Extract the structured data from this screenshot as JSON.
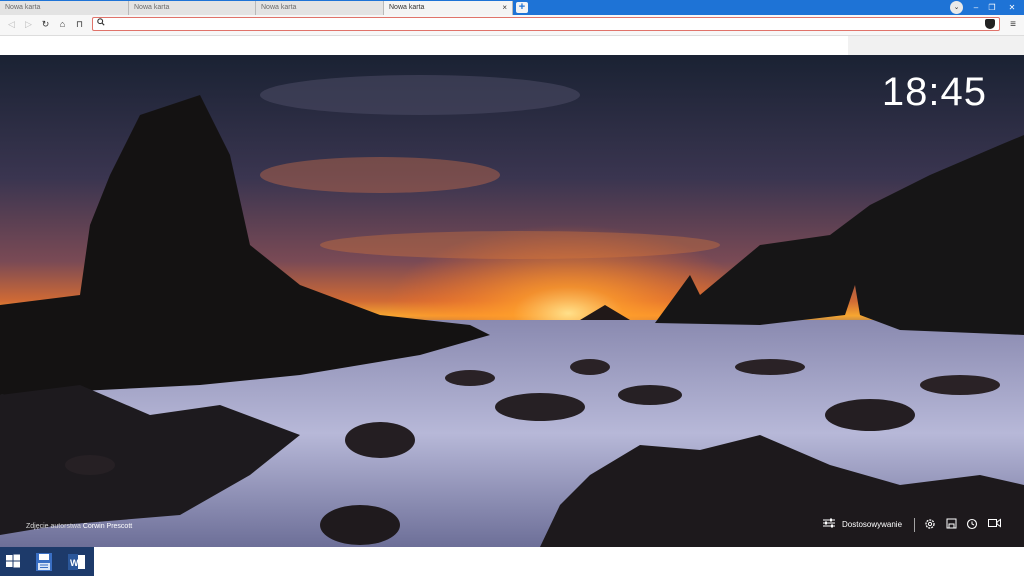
{
  "tabs": [
    {
      "label": "Nowa karta",
      "active": false
    },
    {
      "label": "Nowa karta",
      "active": false
    },
    {
      "label": "Nowa karta",
      "active": false
    },
    {
      "label": "Nowa karta",
      "active": true
    }
  ],
  "tab_close_glyph": "×",
  "new_tab_glyph": "+",
  "window_controls": {
    "minimize": "–",
    "restore": "❐",
    "close": "✕",
    "tab_list": "⌄"
  },
  "toolbar": {
    "back": "◁",
    "forward": "▷",
    "reload": "↻",
    "home": "⌂",
    "bookmark": "⊓",
    "menu": "≡"
  },
  "address_bar": {
    "value": "",
    "placeholder": ""
  },
  "clock": "18:45",
  "photo_credit": {
    "prefix": "Zdjęcie autorstwa",
    "author": "Corwin Prescott"
  },
  "customize_label": "Dostosowywanie",
  "colors": {
    "tab_strip": "#1e73d6",
    "address_focus": "#e0736a",
    "taskbar": "#1d3a6a"
  },
  "bottom_icons": [
    "sliders-icon",
    "gear-icon",
    "save-icon",
    "history-icon",
    "video-icon"
  ],
  "taskbar_icons": [
    "windows-start-icon",
    "save-app-icon",
    "word-app-icon"
  ]
}
